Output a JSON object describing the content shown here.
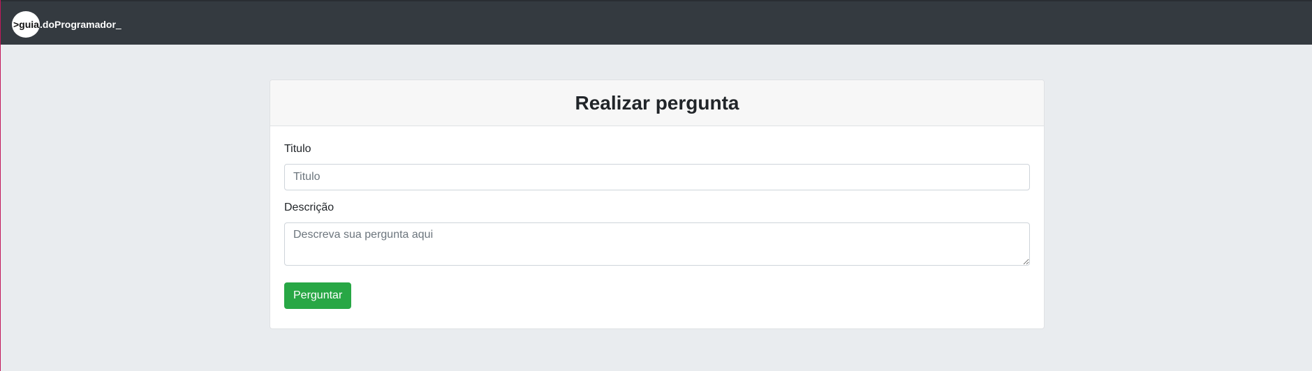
{
  "navbar": {
    "logo_prefix": ">guia",
    "logo_rest": ".doProgramador",
    "logo_cursor": "_"
  },
  "form": {
    "title": "Realizar pergunta",
    "titulo_label": "Titulo",
    "titulo_placeholder": "Titulo",
    "descricao_label": "Descrição",
    "descricao_placeholder": "Descreva sua pergunta aqui",
    "submit_label": "Perguntar"
  },
  "colors": {
    "navbar_bg": "#343a40",
    "page_bg": "#e9ecef",
    "button_bg": "#28a745"
  }
}
